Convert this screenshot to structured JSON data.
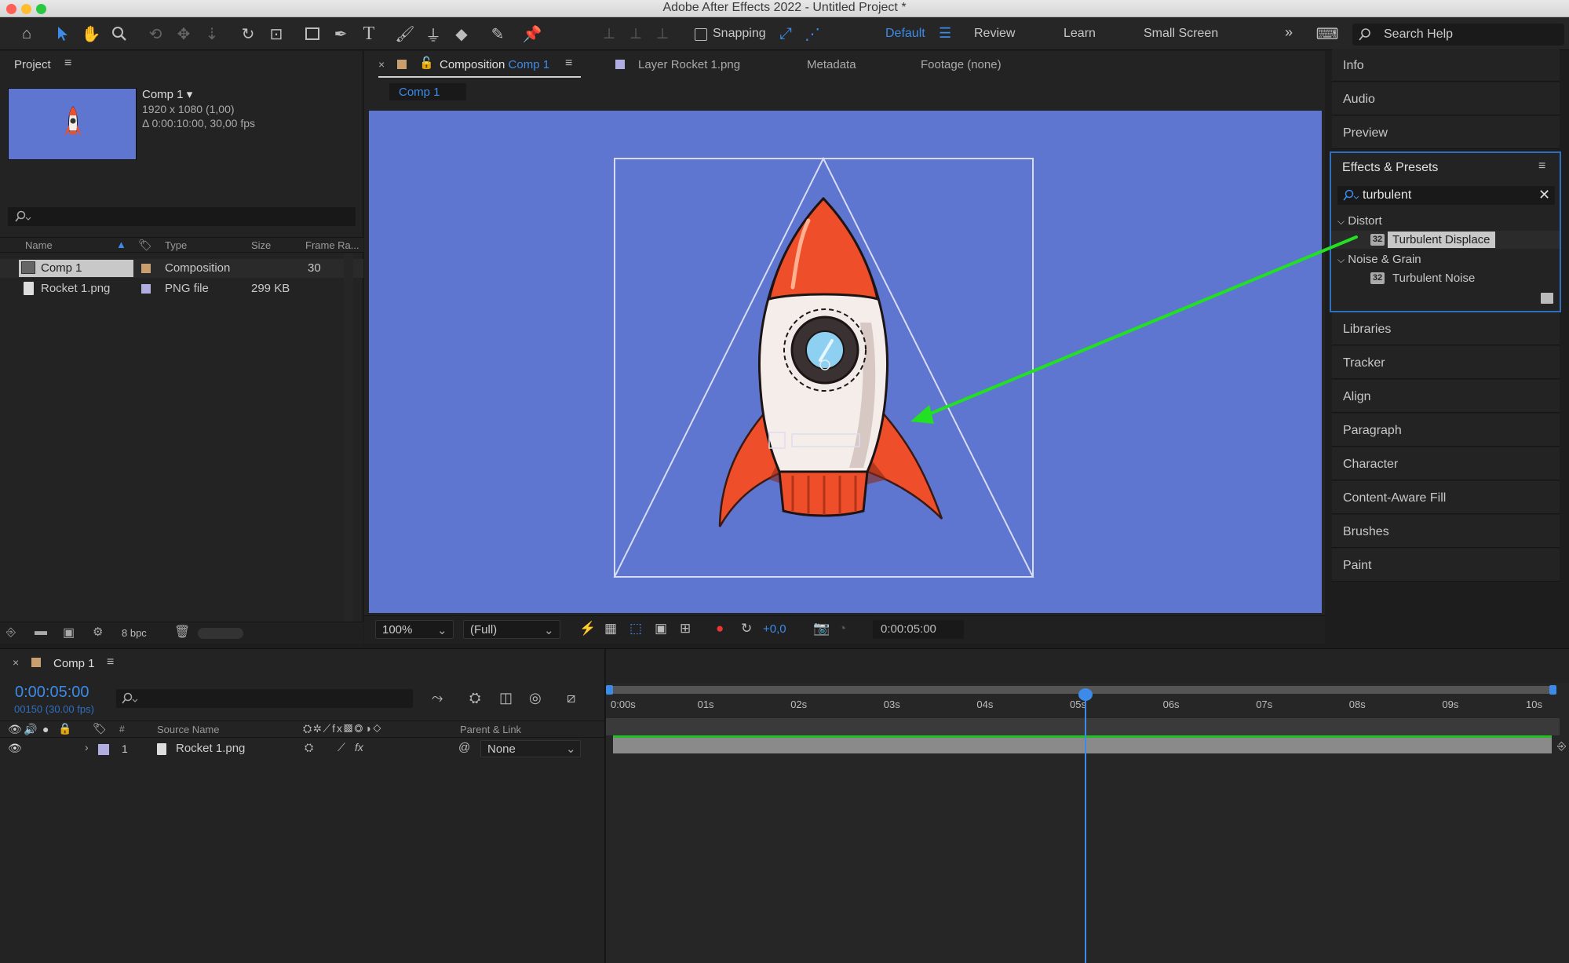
{
  "window": {
    "title": "Adobe After Effects 2022 - Untitled Project *"
  },
  "toolbar": {
    "snapping_label": "Snapping",
    "workspaces": [
      "Default",
      "Review",
      "Learn",
      "Small Screen"
    ],
    "search_placeholder": "Search Help",
    "icons": [
      "home-icon",
      "selection-icon",
      "hand-icon",
      "zoom-icon",
      "orbit-icon",
      "pan-icon",
      "dolly-icon",
      "rotate-icon",
      "anchor-icon",
      "rectangle-icon",
      "pen-icon",
      "type-icon",
      "brush-icon",
      "clone-stamp-icon",
      "eraser-icon",
      "roto-brush-icon",
      "puppet-pin-icon"
    ]
  },
  "project": {
    "title": "Project",
    "comp_name": "Comp 1",
    "comp_size": "1920 x 1080 (1,00)",
    "comp_duration": "Δ 0:00:10:00, 30,00 fps",
    "columns": [
      "Name",
      "Type",
      "Size",
      "Frame Ra..."
    ],
    "items": [
      {
        "name": "Comp 1",
        "type": "Composition",
        "size": "",
        "frame_rate": "30",
        "color": "#c8a070"
      },
      {
        "name": "Rocket 1.png",
        "type": "PNG file",
        "size": "299 KB",
        "frame_rate": "",
        "color": "#b0aee0"
      }
    ],
    "bpc": "8 bpc"
  },
  "viewer": {
    "tabs": [
      {
        "label": "Composition",
        "name": "Comp 1"
      },
      {
        "label": "Layer Rocket 1.png"
      },
      {
        "label": "Metadata"
      },
      {
        "label": "Footage (none)"
      }
    ],
    "comp_chip": "Comp 1",
    "bg_color": "#5f76d1",
    "zoom": "100%",
    "resolution": "(Full)",
    "exposure": "+0,0",
    "timecode": "0:00:05:00"
  },
  "right_panel": {
    "top_items": [
      "Info",
      "Audio",
      "Preview"
    ],
    "effects": {
      "title": "Effects & Presets",
      "search_value": "turbulent",
      "groups": [
        {
          "name": "Distort",
          "items": [
            "Turbulent Displace"
          ]
        },
        {
          "name": "Noise & Grain",
          "items": [
            "Turbulent Noise"
          ]
        }
      ],
      "badge": "32"
    },
    "bottom_items": [
      "Libraries",
      "Tracker",
      "Align",
      "Paragraph",
      "Character",
      "Content-Aware Fill",
      "Brushes",
      "Paint"
    ]
  },
  "timeline": {
    "tab": "Comp 1",
    "timecode": "0:00:05:00",
    "frame_info": "00150 (30.00 fps)",
    "columns": {
      "number": "#",
      "source": "Source Name",
      "parent": "Parent & Link"
    },
    "layer": {
      "index": "1",
      "name": "Rocket 1.png",
      "parent": "None"
    },
    "ruler": [
      "0:00s",
      "01s",
      "02s",
      "03s",
      "04s",
      "05s",
      "06s",
      "07s",
      "08s",
      "09s",
      "10s"
    ],
    "playhead_time": 5,
    "duration": 10
  },
  "colors": {
    "accent": "#3d8be8",
    "arrow": "#22e022",
    "selected_item": "#c8c8c8"
  }
}
